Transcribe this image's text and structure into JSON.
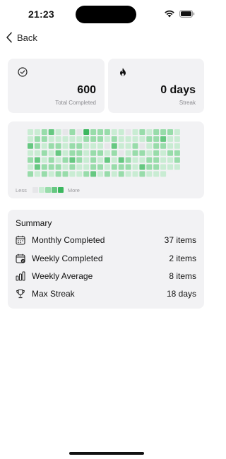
{
  "status_bar": {
    "time": "21:23"
  },
  "nav": {
    "back_label": "Back",
    "icon": "chevron-left-icon"
  },
  "stats": {
    "total_completed": {
      "value": "600",
      "label": "Total Completed",
      "icon": "check-circle-icon"
    },
    "streak": {
      "value": "0 days",
      "label": "Streak",
      "icon": "flame-icon"
    }
  },
  "heatmap": {
    "less_label": "Less",
    "more_label": "More",
    "colors": [
      "#e6e6e9",
      "#c9ecd3",
      "#98dcaa",
      "#66c881",
      "#3cb75f"
    ],
    "rows": [
      [
        1,
        1,
        2,
        3,
        1,
        0,
        2,
        0,
        4,
        2,
        2,
        2,
        1,
        1,
        0,
        1,
        2,
        1,
        2,
        2,
        2,
        1
      ],
      [
        1,
        2,
        2,
        1,
        1,
        1,
        1,
        1,
        2,
        2,
        2,
        1,
        2,
        1,
        1,
        1,
        1,
        2,
        2,
        3,
        1,
        1
      ],
      [
        3,
        2,
        1,
        2,
        2,
        1,
        2,
        2,
        1,
        1,
        1,
        0,
        3,
        1,
        1,
        2,
        0,
        1,
        2,
        2,
        1,
        1
      ],
      [
        1,
        1,
        2,
        1,
        3,
        1,
        2,
        2,
        1,
        2,
        2,
        1,
        2,
        0,
        1,
        2,
        2,
        1,
        2,
        1,
        2,
        2
      ],
      [
        2,
        3,
        1,
        2,
        1,
        2,
        3,
        2,
        1,
        2,
        1,
        3,
        1,
        3,
        2,
        1,
        1,
        2,
        2,
        1,
        1,
        2
      ],
      [
        1,
        3,
        2,
        2,
        2,
        1,
        2,
        1,
        1,
        2,
        2,
        1,
        2,
        2,
        2,
        1,
        3,
        2,
        2,
        1,
        1,
        1
      ],
      [
        2,
        1,
        2,
        1,
        2,
        2,
        1,
        1,
        2,
        3,
        1,
        2,
        1,
        2,
        1,
        1,
        2,
        1,
        1,
        1
      ]
    ]
  },
  "summary": {
    "title": "Summary",
    "rows": [
      {
        "icon": "calendar-icon",
        "label": "Monthly Completed",
        "value": "37 items"
      },
      {
        "icon": "calendar-week-icon",
        "label": "Weekly Completed",
        "value": "2 items"
      },
      {
        "icon": "bar-chart-icon",
        "label": "Weekly Average",
        "value": "8 items"
      },
      {
        "icon": "trophy-icon",
        "label": "Max Streak",
        "value": "18 days"
      }
    ]
  }
}
